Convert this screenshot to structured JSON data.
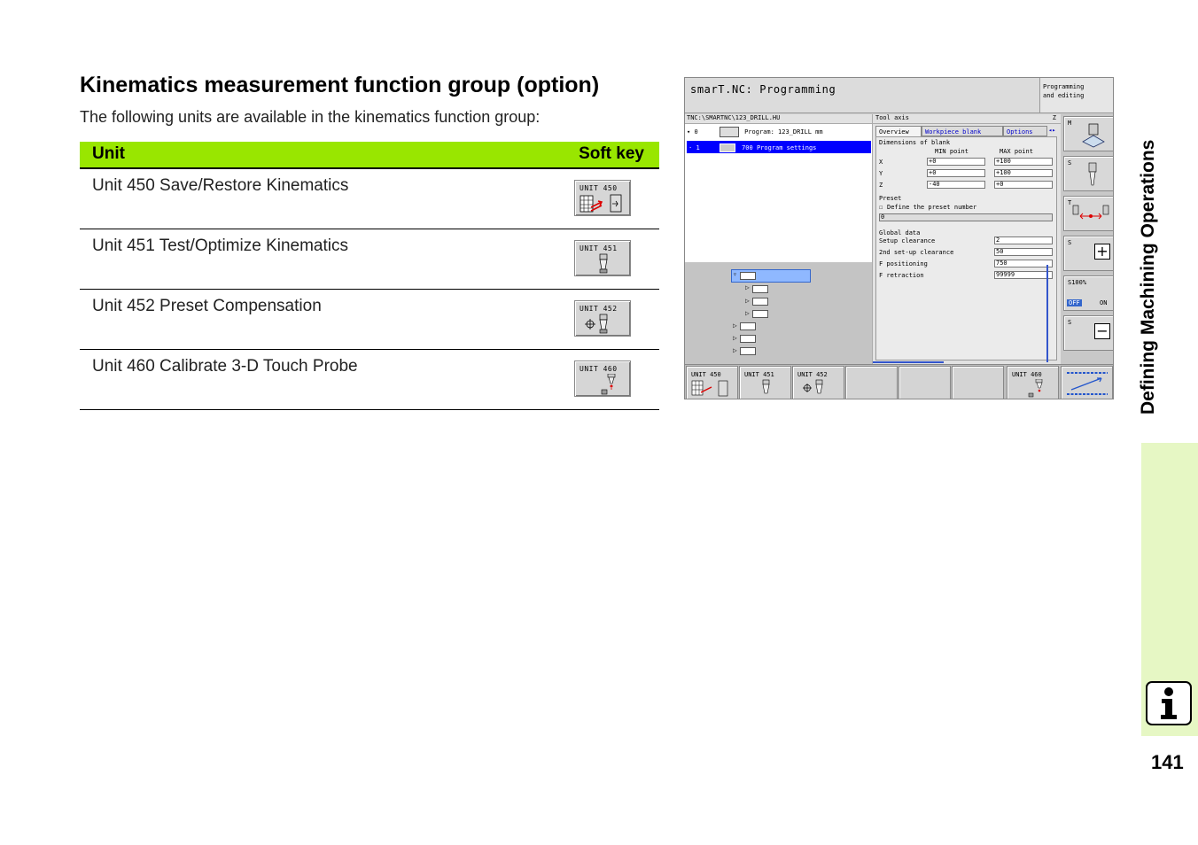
{
  "heading": "Kinematics measurement function group (option)",
  "intro": "The following units are available in the kinematics function group:",
  "table": {
    "col_unit": "Unit",
    "col_softkey": "Soft key",
    "rows": [
      {
        "label": "Unit 450 Save/Restore Kinematics",
        "key": "UNIT 450"
      },
      {
        "label": "Unit 451 Test/Optimize Kinematics",
        "key": "UNIT 451"
      },
      {
        "label": "Unit 452 Preset Compensation",
        "key": "UNIT 452"
      },
      {
        "label": "Unit 460 Calibrate 3-D Touch Probe",
        "key": "UNIT 460"
      }
    ]
  },
  "screen": {
    "title": "smarT.NC: Programming",
    "mode_line1": "Programming",
    "mode_line2": "and editing",
    "path": "TNC:\\SMARTNC\\123_DRILL.HU",
    "tree_row0_index": "0",
    "tree_row0_text": "Program: 123_DRILL mm",
    "tree_row1_index": "1",
    "tree_row1_text": "700 Program settings",
    "form_header": "Tool axis",
    "form_axis": "Z",
    "tabs": [
      "Overview",
      "Workpiece blank",
      "Options"
    ],
    "blank_title": "Dimensions of blank",
    "min_label": "MIN point",
    "max_label": "MAX point",
    "axes": [
      {
        "name": "X",
        "min": "+0",
        "max": "+100"
      },
      {
        "name": "Y",
        "min": "+0",
        "max": "+100"
      },
      {
        "name": "Z",
        "min": "-40",
        "max": "+0"
      }
    ],
    "preset_title": "Preset",
    "preset_check": "Define the preset number",
    "preset_value": "0",
    "global_title": "Global data",
    "global": [
      {
        "label": "Setup clearance",
        "value": "2"
      },
      {
        "label": "2nd set-up clearance",
        "value": "50"
      },
      {
        "label": "F positioning",
        "value": "750"
      },
      {
        "label": "F retraction",
        "value": "99999"
      }
    ],
    "side_keys": [
      "M",
      "S",
      "T",
      "S",
      "S100%",
      "S"
    ],
    "side_off": "OFF",
    "side_on": "ON",
    "bottom_keys": [
      "UNIT 450",
      "UNIT 451",
      "UNIT 452",
      "",
      "",
      "",
      "UNIT 460",
      ""
    ]
  },
  "thumb_text": "Defining Machining Operations",
  "page_number": "141",
  "colors": {
    "table_header": "#99e600",
    "thumb": "#e6f7c4",
    "selection": "#0000ff"
  }
}
